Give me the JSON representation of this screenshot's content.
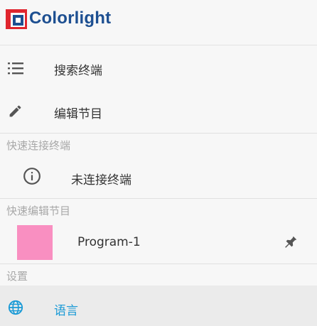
{
  "app": {
    "logo_text": "Colorlight"
  },
  "menu": {
    "search_terminal": "搜索终端",
    "edit_program": "编辑节目"
  },
  "quick_connect": {
    "header": "快速连接终端",
    "status": "未连接终端"
  },
  "quick_edit": {
    "header": "快速编辑节目",
    "program_name": "Program-1",
    "thumbnail_color": "#f98fc1"
  },
  "settings": {
    "header": "设置",
    "language": "语言"
  },
  "colors": {
    "accent": "#1a9ad6",
    "logo_text": "#1d4f91",
    "logo_red": "#e0262e",
    "logo_blue": "#1d4f91"
  },
  "icons": {
    "search_terminal": "list-icon",
    "edit_program": "pencil-icon",
    "status": "info-icon",
    "program_pin": "pin-icon",
    "language": "globe-icon"
  }
}
